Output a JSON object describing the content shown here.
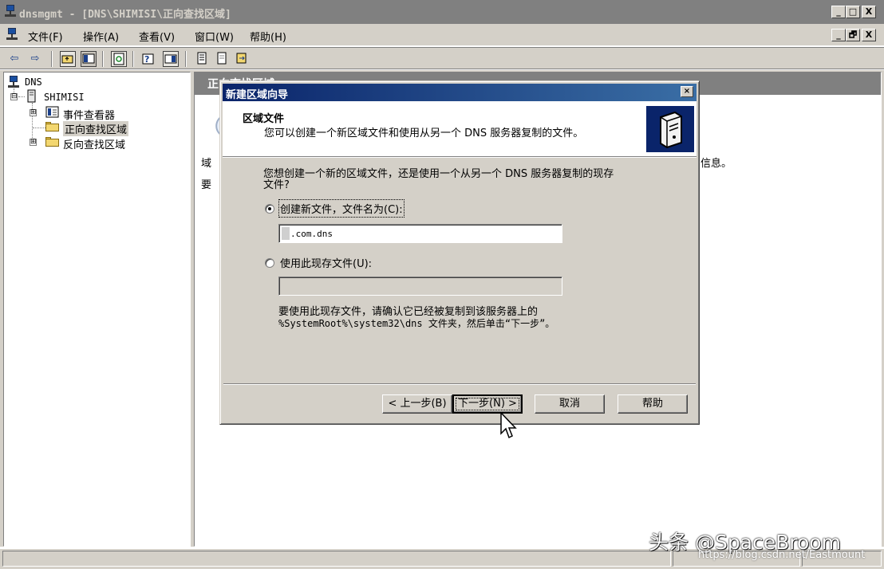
{
  "window": {
    "title": "dnsmgmt - [DNS\\SHIMISI\\正向查找区域]",
    "caption_buttons": [
      "_",
      "□",
      "X"
    ],
    "mdi_buttons": [
      "_",
      "🗗",
      "X"
    ]
  },
  "menu": {
    "items": [
      "文件(F)",
      "操作(A)",
      "查看(V)",
      "窗口(W)",
      "帮助(H)"
    ]
  },
  "toolbar": {
    "back": "⇦",
    "forward": "⇨"
  },
  "tree": {
    "root": "DNS",
    "server": "SHIMISI",
    "children": [
      "事件查看器",
      "正向查找区域",
      "反向查找区域"
    ],
    "expanders": [
      "⊟",
      "⊞",
      "⊞"
    ]
  },
  "right_pane": {
    "header": "正向查找区域",
    "partial_line1": "域",
    "partial_line2": "要",
    "partial_right": "信息。"
  },
  "dialog": {
    "title": "新建区域向导",
    "close": "×",
    "header_title": "区域文件",
    "header_subtitle": "您可以创建一个新区域文件和使用从另一个 DNS 服务器复制的文件。",
    "question_line1": "您想创建一个新的区域文件，还是使用一个从另一个 DNS 服务器复制的现存",
    "question_line2": "文件?",
    "option_new_label": "创建新文件，文件名为(C):",
    "option_new_value": ".com.dns",
    "option_existing_label": "使用此现存文件(U):",
    "option_existing_value": "",
    "note_line1": "要使用此现存文件，请确认它已经被复制到该服务器上的",
    "note_line2": "%SystemRoot%\\system32\\dns 文件夹，然后单击“下一步”。",
    "buttons": {
      "back": "< 上一步(B)",
      "next": "下一步(N) >",
      "cancel": "取消",
      "help": "帮助"
    }
  },
  "watermark": {
    "main": "头条 @SpaceBroom",
    "sub": "https://blog.csdn.net/Eastmount"
  },
  "colors": {
    "face": "#d4d0c8",
    "active_title": "#0a246a",
    "inactive_title": "#808080"
  }
}
